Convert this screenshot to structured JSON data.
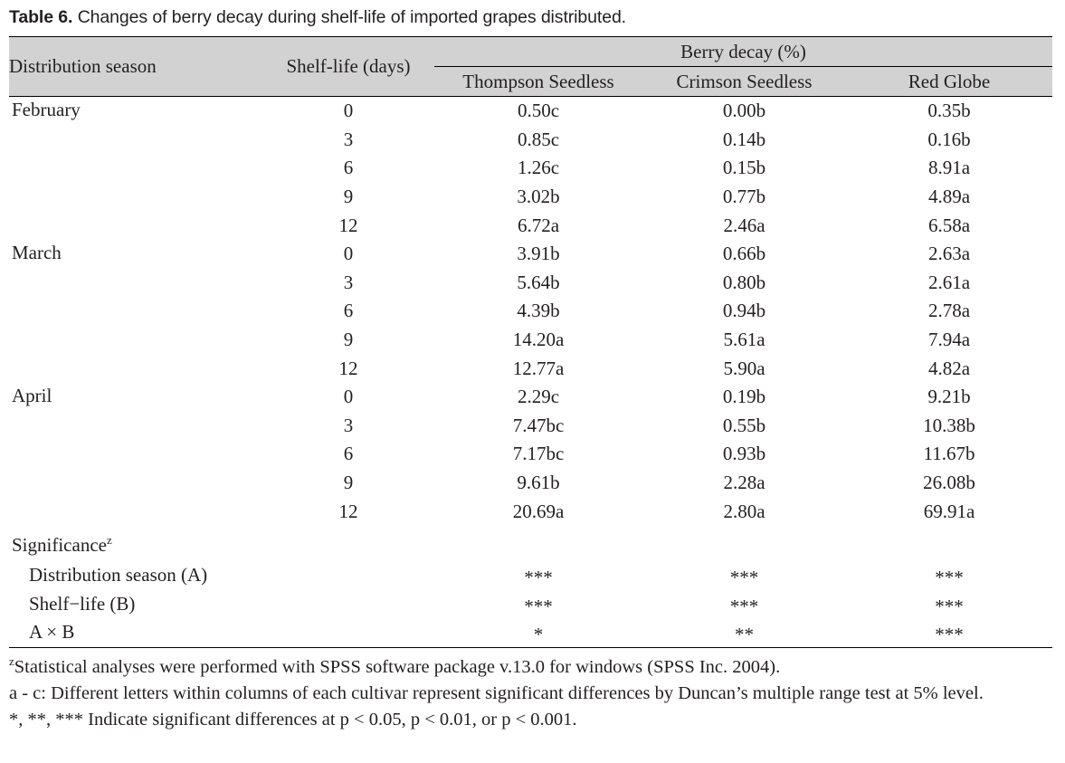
{
  "caption": {
    "label": "Table 6.",
    "text": "Changes of berry decay during shelf-life of imported grapes distributed."
  },
  "table": {
    "headers": {
      "season": "Distribution season",
      "shelf_life": "Shelf-life (days)",
      "group": "Berry decay (%)",
      "cultivars": [
        "Thompson Seedless",
        "Crimson Seedless",
        "Red Globe"
      ]
    },
    "groups": [
      {
        "season": "February",
        "rows": [
          {
            "shelf_life": "0",
            "thompson": "0.50c",
            "crimson": "0.00b",
            "red_globe": "0.35b"
          },
          {
            "shelf_life": "3",
            "thompson": "0.85c",
            "crimson": "0.14b",
            "red_globe": "0.16b"
          },
          {
            "shelf_life": "6",
            "thompson": "1.26c",
            "crimson": "0.15b",
            "red_globe": "8.91a"
          },
          {
            "shelf_life": "9",
            "thompson": "3.02b",
            "crimson": "0.77b",
            "red_globe": "4.89a"
          },
          {
            "shelf_life": "12",
            "thompson": "6.72a",
            "crimson": "2.46a",
            "red_globe": "6.58a"
          }
        ]
      },
      {
        "season": "March",
        "rows": [
          {
            "shelf_life": "0",
            "thompson": "3.91b",
            "crimson": "0.66b",
            "red_globe": "2.63a"
          },
          {
            "shelf_life": "3",
            "thompson": "5.64b",
            "crimson": "0.80b",
            "red_globe": "2.61a"
          },
          {
            "shelf_life": "6",
            "thompson": "4.39b",
            "crimson": "0.94b",
            "red_globe": "2.78a"
          },
          {
            "shelf_life": "9",
            "thompson": "14.20a",
            "crimson": "5.61a",
            "red_globe": "7.94a"
          },
          {
            "shelf_life": "12",
            "thompson": "12.77a",
            "crimson": "5.90a",
            "red_globe": "4.82a"
          }
        ]
      },
      {
        "season": "April",
        "rows": [
          {
            "shelf_life": "0",
            "thompson": "2.29c",
            "crimson": "0.19b",
            "red_globe": "9.21b"
          },
          {
            "shelf_life": "3",
            "thompson": "7.47bc",
            "crimson": "0.55b",
            "red_globe": "10.38b"
          },
          {
            "shelf_life": "6",
            "thompson": "7.17bc",
            "crimson": "0.93b",
            "red_globe": "11.67b"
          },
          {
            "shelf_life": "9",
            "thompson": "9.61b",
            "crimson": "2.28a",
            "red_globe": "26.08b"
          },
          {
            "shelf_life": "12",
            "thompson": "20.69a",
            "crimson": "2.80a",
            "red_globe": "69.91a"
          }
        ]
      }
    ],
    "significance": {
      "title": "Significance",
      "title_superscript": "z",
      "rows": [
        {
          "name": "Distribution season (A)",
          "thompson": "***",
          "crimson": "***",
          "red_globe": "***"
        },
        {
          "name": "Shelf−life (B)",
          "thompson": "***",
          "crimson": "***",
          "red_globe": "***"
        },
        {
          "name": "A × B",
          "thompson": "*",
          "crimson": "**",
          "red_globe": "***"
        }
      ]
    }
  },
  "footnotes": {
    "note1_superscript": "z",
    "note1": "Statistical analyses were performed with SPSS software package v.13.0 for windows (SPSS Inc. 2004).",
    "note2": "a - c: Different letters within columns of each cultivar represent significant differences by Duncan’s multiple range test at 5% level.",
    "note3": "*, **, *** Indicate significant differences at p < 0.05, p < 0.01, or p < 0.001."
  },
  "colors": {
    "header_band": "#d2d2d2",
    "rule": "#000000",
    "text": "#231f20"
  }
}
